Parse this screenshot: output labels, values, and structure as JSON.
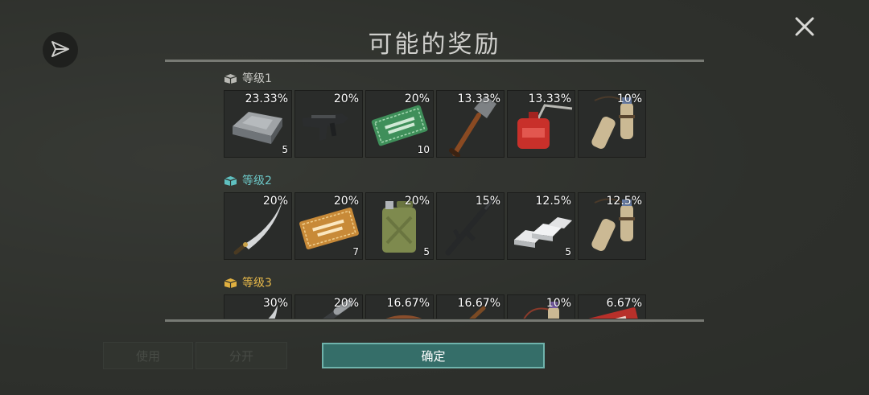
{
  "title": "可能的奖励",
  "confirm_label": "确定",
  "background_buttons": [
    "使用",
    "分开"
  ],
  "tiers": [
    {
      "label": "等级1",
      "color": "#b9b9b4",
      "items": [
        {
          "name": "iron-ingot",
          "pct": "23.33%",
          "qty": "5"
        },
        {
          "name": "uzi-gun",
          "pct": "20%",
          "qty": ""
        },
        {
          "name": "ration-coupon",
          "pct": "20%",
          "qty": "10"
        },
        {
          "name": "shovel",
          "pct": "13.33%",
          "qty": ""
        },
        {
          "name": "oil-can",
          "pct": "13.33%",
          "qty": ""
        },
        {
          "name": "tube-case",
          "pct": "10%",
          "qty": ""
        }
      ]
    },
    {
      "label": "等级2",
      "color": "#5fc0c0",
      "items": [
        {
          "name": "machete",
          "pct": "20%",
          "qty": ""
        },
        {
          "name": "survival-kit-coupon",
          "pct": "20%",
          "qty": "7"
        },
        {
          "name": "jerrycan",
          "pct": "20%",
          "qty": "5"
        },
        {
          "name": "rifle",
          "pct": "15%",
          "qty": ""
        },
        {
          "name": "silver-ingots",
          "pct": "12.5%",
          "qty": "5"
        },
        {
          "name": "tube-case",
          "pct": "12.5%",
          "qty": ""
        }
      ]
    },
    {
      "label": "等级3",
      "color": "#e0b040",
      "items": [
        {
          "name": "blade",
          "pct": "30%",
          "qty": ""
        },
        {
          "name": "flashlight",
          "pct": "20%",
          "qty": ""
        },
        {
          "name": "leather",
          "pct": "16.67%",
          "qty": ""
        },
        {
          "name": "stick",
          "pct": "16.67%",
          "qty": ""
        },
        {
          "name": "tube-case",
          "pct": "10%",
          "qty": ""
        },
        {
          "name": "gear-box",
          "pct": "6.67%",
          "qty": ""
        }
      ]
    }
  ]
}
